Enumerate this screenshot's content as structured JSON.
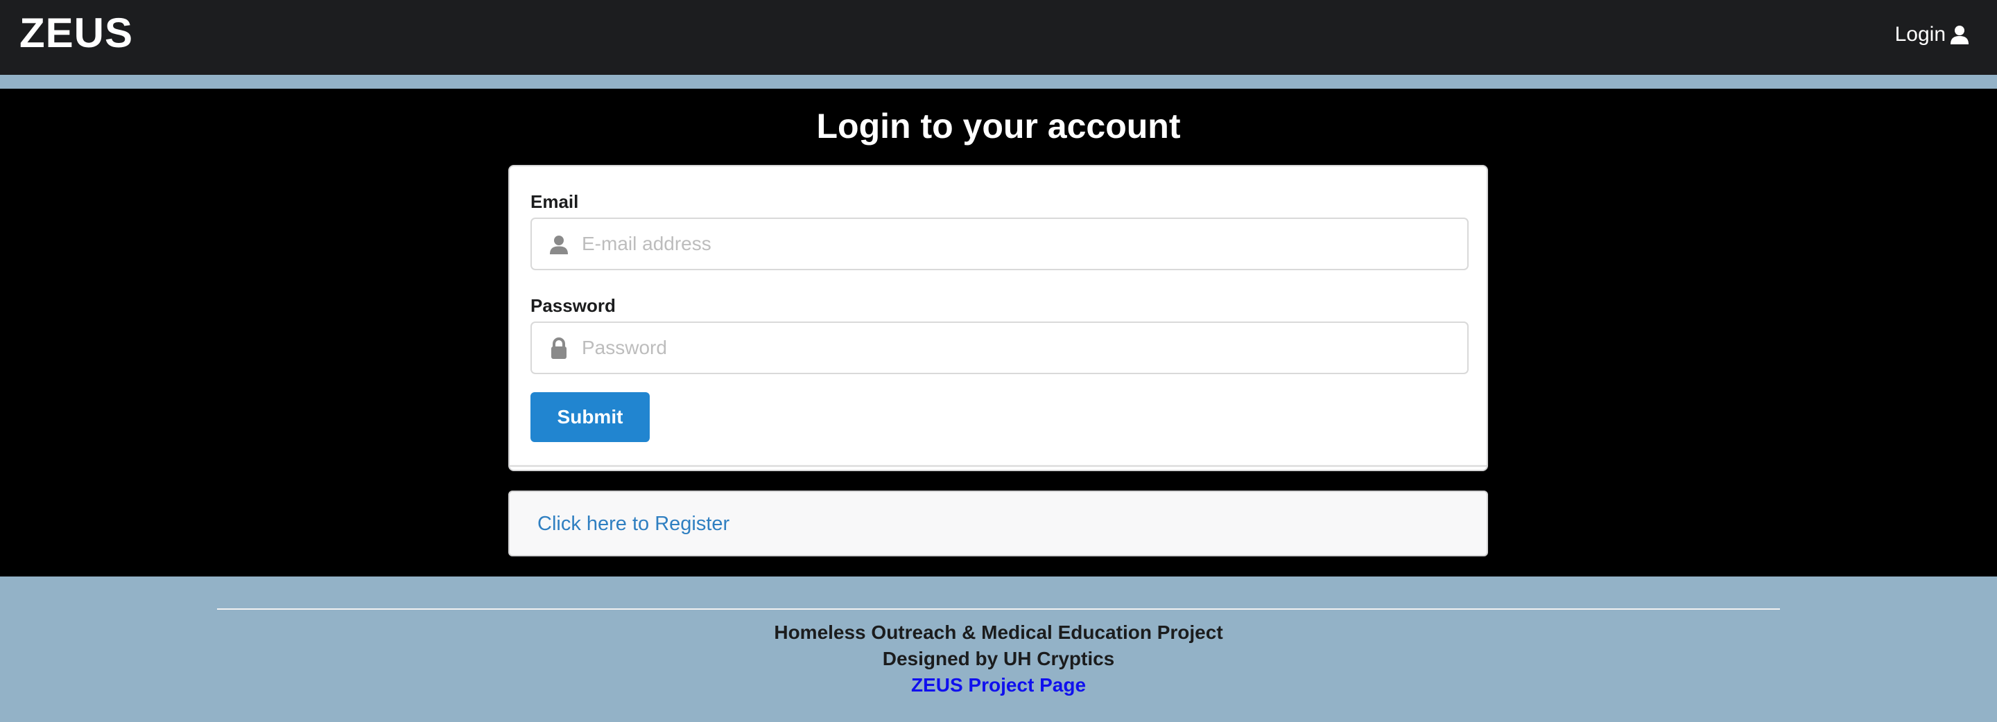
{
  "navbar": {
    "brand": "ZEUS",
    "login_label": "Login",
    "login_icon": "user-icon"
  },
  "main": {
    "title": "Login to your account",
    "form": {
      "email_label": "Email",
      "email_placeholder": "E-mail address",
      "email_value": "",
      "email_icon": "user-icon",
      "password_label": "Password",
      "password_placeholder": "Password",
      "password_value": "",
      "password_icon": "lock-icon",
      "submit_label": "Submit"
    },
    "register_link": "Click here to Register"
  },
  "footer": {
    "line1": "Homeless Outreach & Medical Education Project",
    "line2": "Designed by UH Cryptics",
    "project_link": "ZEUS Project Page"
  },
  "colors": {
    "navbar_bg": "#1c1d1f",
    "page_bg": "#93b2c7",
    "main_bg": "#000000",
    "primary_button": "#2185d0",
    "register_link": "#2f7fc1",
    "footer_link": "#1010ee"
  }
}
